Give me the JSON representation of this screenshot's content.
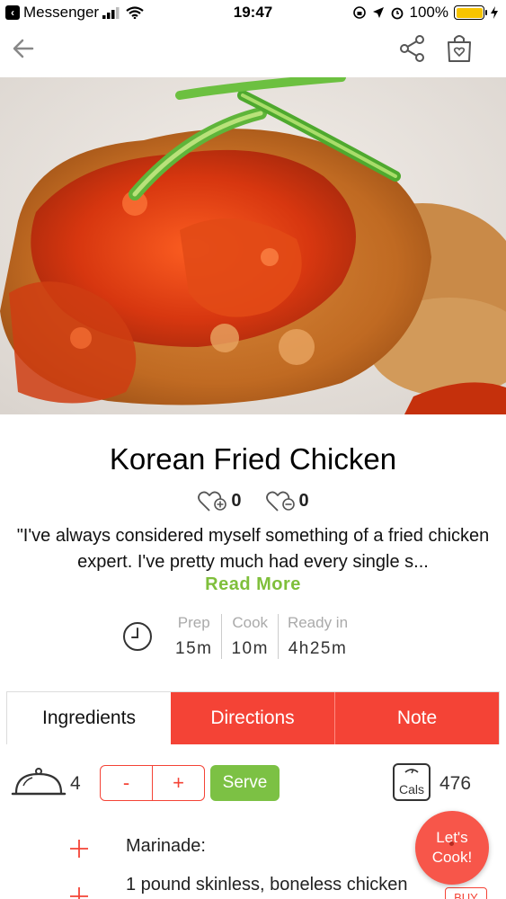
{
  "status_bar": {
    "back_app": "Messenger",
    "time": "19:47",
    "battery": "100%"
  },
  "recipe": {
    "title": "Korean Fried Chicken",
    "likes": "0",
    "dislikes": "0",
    "description": "\"I've always considered myself something of a fried chicken expert. I've pretty much had every single s...",
    "read_more": "Read More"
  },
  "times": {
    "prep_label": "Prep",
    "prep_value": "15m",
    "cook_label": "Cook",
    "cook_value": "10m",
    "ready_label": "Ready in",
    "ready_value": "4h25m"
  },
  "tabs": [
    {
      "label": "Ingredients",
      "active": true
    },
    {
      "label": "Directions",
      "active": false
    },
    {
      "label": "Note",
      "active": false
    }
  ],
  "servings": {
    "count": "4",
    "minus": "-",
    "plus": "+",
    "serve_label": "Serve",
    "cals_icon_label": "Cals",
    "calories": "476"
  },
  "ingredients": [
    {
      "text": "Marinade:"
    },
    {
      "text": "1 pound skinless, boneless chicken",
      "buy": "BUY"
    }
  ],
  "fab": {
    "line1": "Let's",
    "line2": "Cook!"
  },
  "colors": {
    "accent_red": "#f44336",
    "accent_green": "#7cc144",
    "read_more_green": "#7fbf3b"
  }
}
